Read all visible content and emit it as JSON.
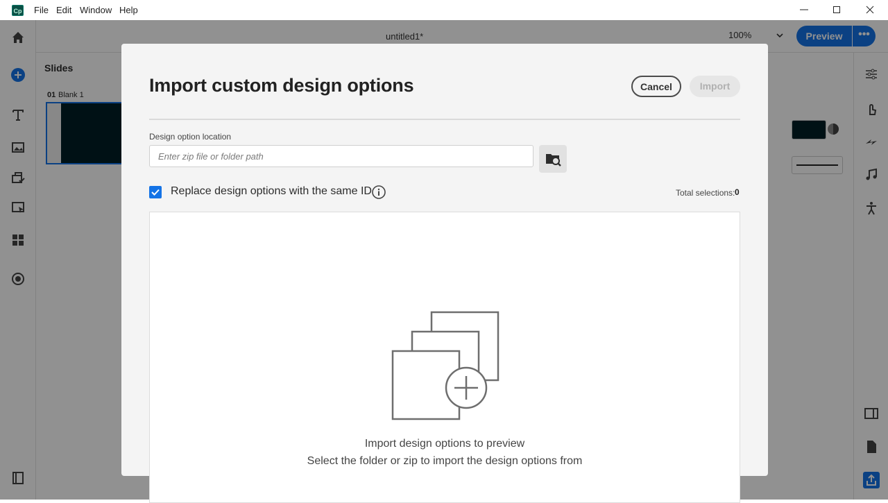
{
  "window": {
    "app_icon_text": "Cp",
    "menu": [
      "File",
      "Edit",
      "Window",
      "Help"
    ]
  },
  "app": {
    "doc_title": "untitled1*",
    "zoom": "100%",
    "preview_label": "Preview",
    "more_label": "•••",
    "slides_title": "Slides",
    "slide_number": "01",
    "slide_name": "Blank 1",
    "accent_color": "#1473e6"
  },
  "dialog": {
    "title": "Import custom design options",
    "cancel_label": "Cancel",
    "import_label": "Import",
    "location_label": "Design option location",
    "location_placeholder": "Enter zip file or folder path",
    "replace_checked": true,
    "replace_label": "Replace design options with the same ID",
    "total_label": "Total selections:",
    "total_value": "0",
    "empty_title": "Import design options to preview",
    "empty_subtitle": "Select the folder or zip to import the design options from"
  }
}
